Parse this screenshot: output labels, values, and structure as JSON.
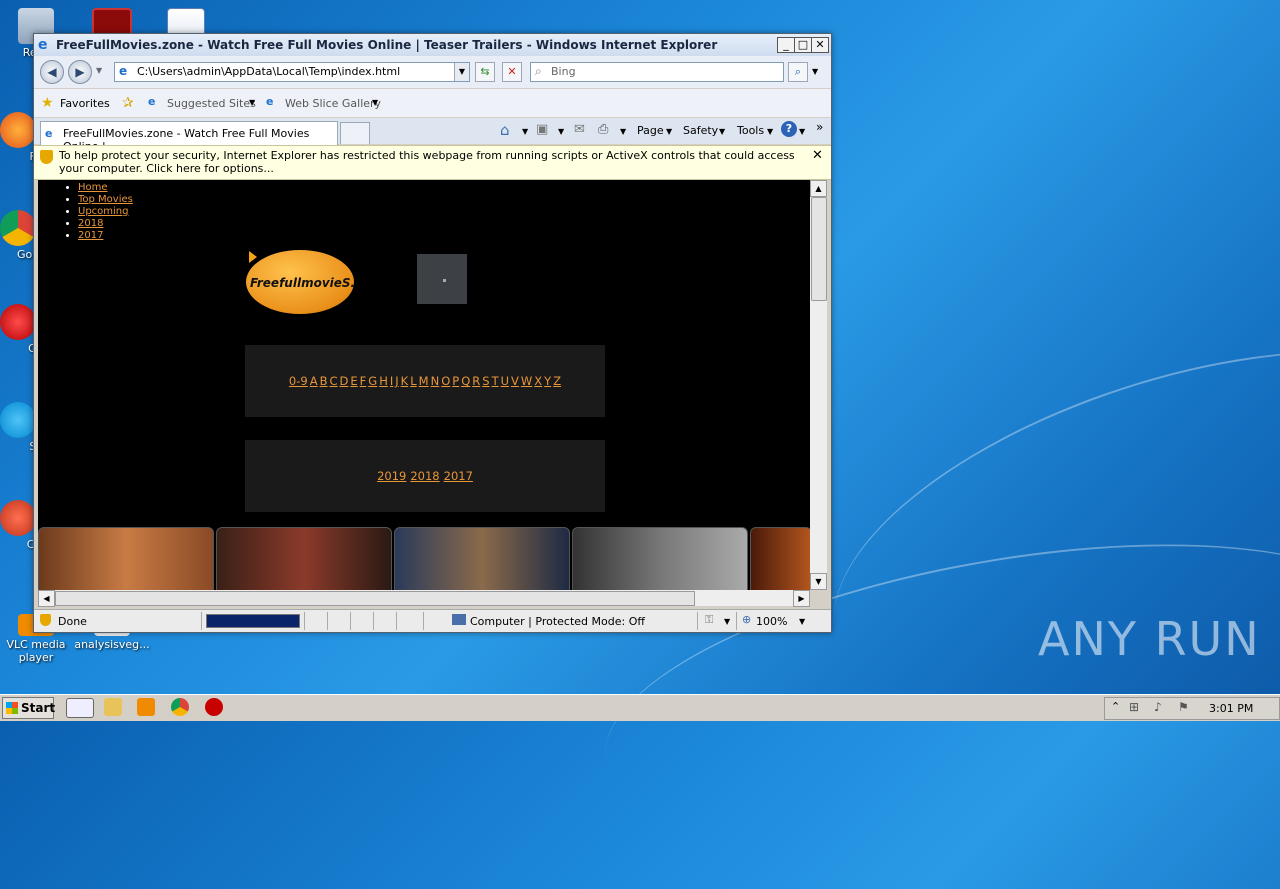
{
  "desktop": {
    "icons": [
      {
        "label": "Recy"
      },
      {
        "label": "Fir"
      },
      {
        "label": "Go Chr"
      },
      {
        "label": "Op"
      },
      {
        "label": "Sk"
      },
      {
        "label": "CCl"
      },
      {
        "label": "VLC media player"
      },
      {
        "label": "analysisveg..."
      }
    ]
  },
  "window": {
    "title": "FreeFullMovies.zone - Watch Free Full Movies Online | Teaser Trailers - Windows Internet Explorer",
    "address": "C:\\Users\\admin\\AppData\\Local\\Temp\\index.html",
    "search_placeholder": "Bing",
    "favorites": {
      "label": "Favorites",
      "suggested": "Suggested Sites",
      "webslice": "Web Slice Gallery"
    },
    "tab_title": "FreeFullMovies.zone - Watch Free Full Movies Online |...",
    "commands": {
      "page": "Page",
      "safety": "Safety",
      "tools": "Tools"
    },
    "infobar": "To help protect your security, Internet Explorer has restricted this webpage from running scripts or ActiveX controls that could access your computer. Click here for options...",
    "status": {
      "text": "Done",
      "zone": "Computer | Protected Mode: Off",
      "zoom": "100%"
    }
  },
  "page": {
    "nav": [
      "Home",
      "Top Movies",
      "Upcoming",
      "2018",
      "2017"
    ],
    "logo_text": "FreefullmovieS.",
    "az": [
      "0-9",
      "A",
      "B",
      "C",
      "D",
      "E",
      "F",
      "G",
      "H",
      "I",
      "J",
      "K",
      "L",
      "M",
      "N",
      "O",
      "P",
      "Q",
      "R",
      "S",
      "T",
      "U",
      "V",
      "W",
      "X",
      "Y",
      "Z"
    ],
    "years": [
      "2019",
      "2018",
      "2017"
    ]
  },
  "taskbar": {
    "start": "Start",
    "time": "3:01 PM"
  },
  "watermark": "ANY RUN"
}
